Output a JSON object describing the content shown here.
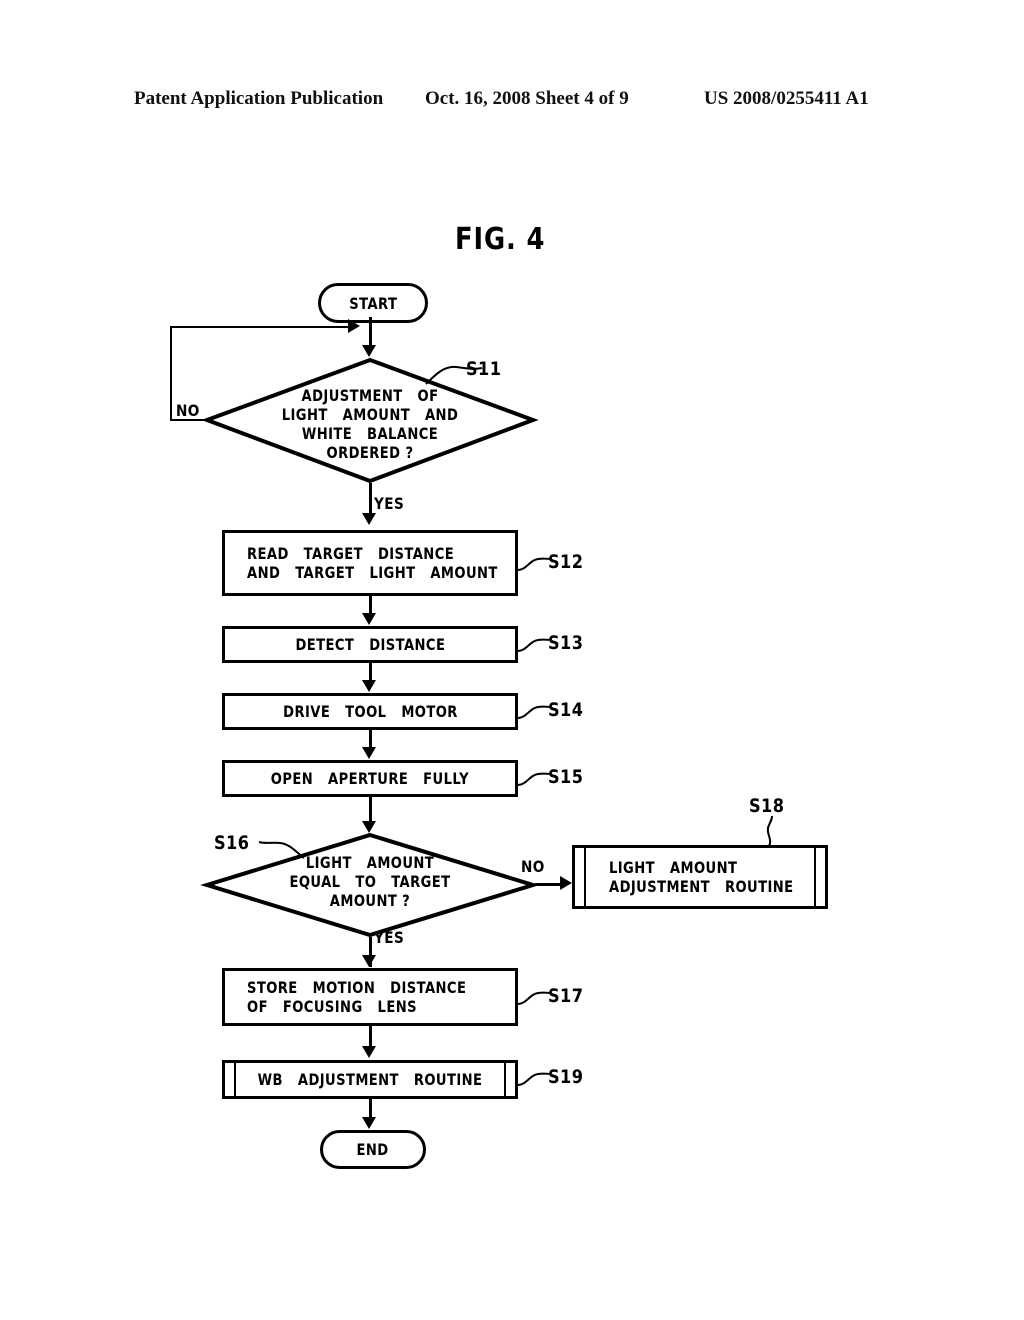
{
  "header": {
    "left": "Patent Application Publication",
    "middle": "Oct. 16, 2008  Sheet 4 of 9",
    "right": "US 2008/0255411 A1"
  },
  "figure": {
    "title": "FIG. 4"
  },
  "nodes": {
    "start": {
      "label": "START",
      "step": ""
    },
    "s11": {
      "line1": "ADJUSTMENT   OF",
      "line2": "LIGHT   AMOUNT   AND",
      "line3": "WHITE   BALANCE",
      "line4": "ORDERED ?",
      "step": "S11",
      "yes": "YES",
      "no": "NO"
    },
    "s12": {
      "line1": "READ   TARGET   DISTANCE",
      "line2": "AND   TARGET   LIGHT   AMOUNT",
      "step": "S12"
    },
    "s13": {
      "label": "DETECT   DISTANCE",
      "step": "S13"
    },
    "s14": {
      "label": "DRIVE   TOOL   MOTOR",
      "step": "S14"
    },
    "s15": {
      "label": "OPEN   APERTURE   FULLY",
      "step": "S15"
    },
    "s16": {
      "line1": "LIGHT   AMOUNT",
      "line2": "EQUAL   TO   TARGET",
      "line3": "AMOUNT ?",
      "step": "S16",
      "yes": "YES",
      "no": "NO"
    },
    "s17": {
      "line1": "STORE   MOTION   DISTANCE",
      "line2": "OF   FOCUSING   LENS",
      "step": "S17"
    },
    "s18": {
      "line1": "LIGHT   AMOUNT",
      "line2": "ADJUSTMENT   ROUTINE",
      "step": "S18"
    },
    "s19": {
      "label": "WB   ADJUSTMENT   ROUTINE",
      "step": "S19"
    },
    "end": {
      "label": "END"
    }
  },
  "colors": {
    "ink": "#000000",
    "paper": "#ffffff"
  }
}
